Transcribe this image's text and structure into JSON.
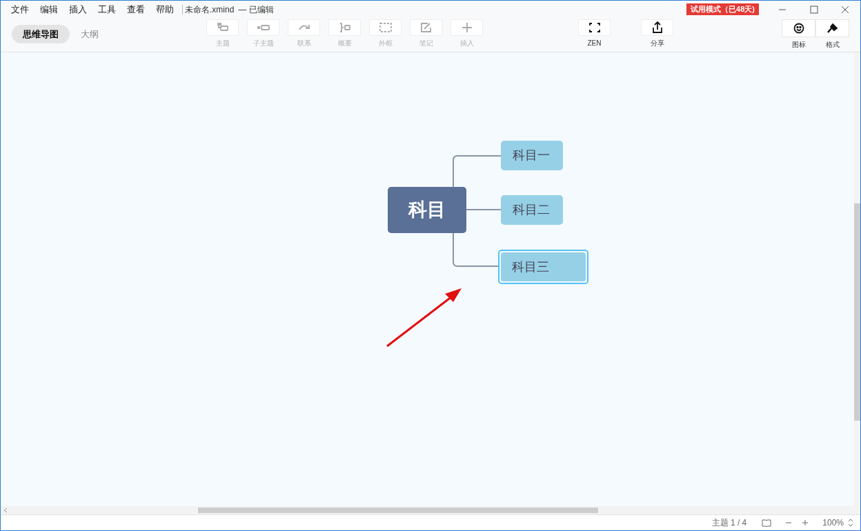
{
  "menu": [
    "文件",
    "编辑",
    "插入",
    "工具",
    "查看",
    "帮助"
  ],
  "document": {
    "file_name": "未命名.xmind",
    "status": "— 已编辑"
  },
  "trial_badge": "试用模式（已48天)",
  "view_tabs": [
    {
      "label": "思维导图",
      "selected": true
    },
    {
      "label": "大纲",
      "selected": false
    }
  ],
  "toolbar": [
    {
      "kind": "topic",
      "label": "主题",
      "disabled": true
    },
    {
      "kind": "subtopic",
      "label": "子主题",
      "disabled": true
    },
    {
      "kind": "relation",
      "label": "联系",
      "disabled": true
    },
    {
      "kind": "summary",
      "label": "概要",
      "disabled": true
    },
    {
      "kind": "boundary",
      "label": "外框",
      "disabled": true
    },
    {
      "kind": "note",
      "label": "笔记",
      "disabled": true
    },
    {
      "kind": "insert",
      "label": "插入",
      "disabled": true
    }
  ],
  "actions": [
    {
      "kind": "zen",
      "label": "ZEN"
    },
    {
      "kind": "share",
      "label": "分享"
    }
  ],
  "panels": [
    {
      "kind": "icon",
      "label": "图标"
    },
    {
      "kind": "format",
      "label": "格式"
    }
  ],
  "mind_map": {
    "root": "科目",
    "children": [
      {
        "label": "科目一",
        "selected": false
      },
      {
        "label": "科目二",
        "selected": false
      },
      {
        "label": "科目三",
        "selected": true
      }
    ]
  },
  "status_bar": {
    "topic_count": "主题 1 / 4",
    "zoom": "100%"
  }
}
